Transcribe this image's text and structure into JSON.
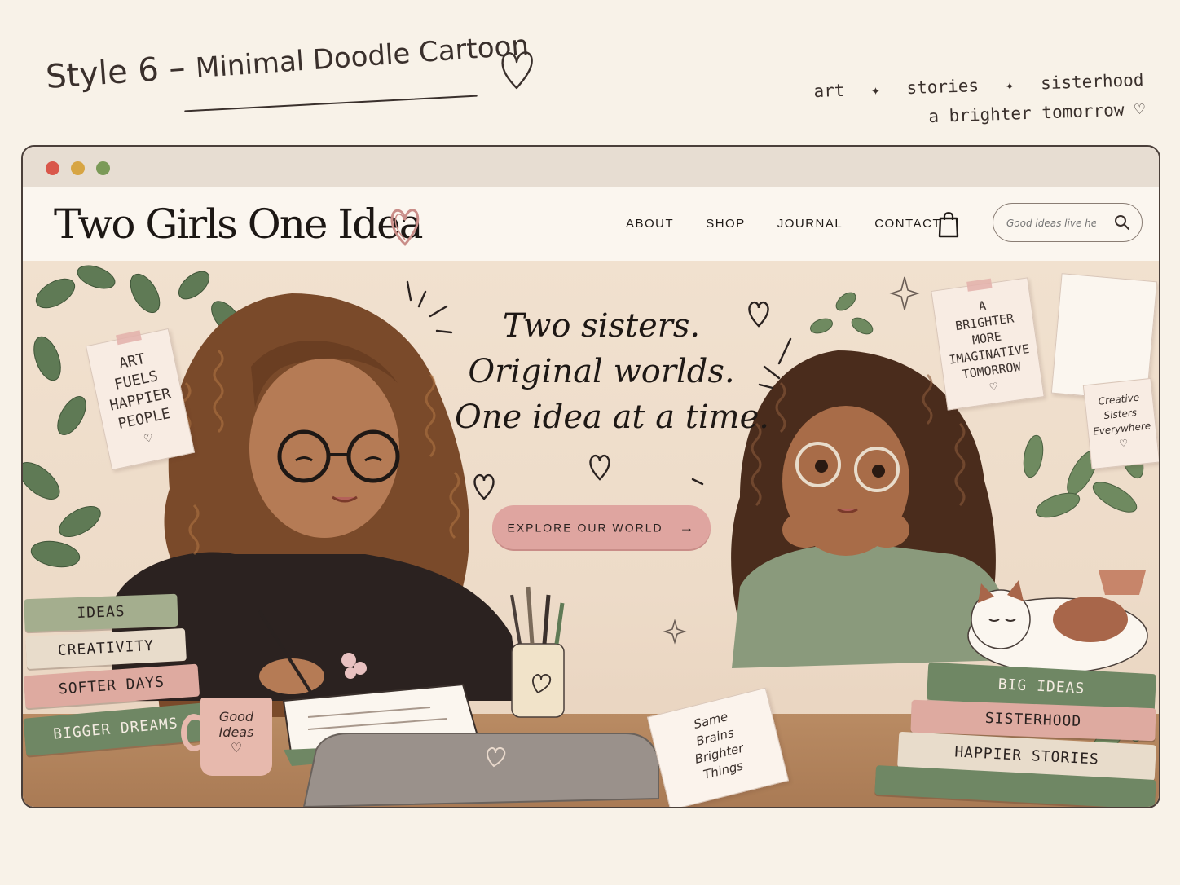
{
  "page": {
    "style_title": "Style 6",
    "style_dash": "–",
    "style_subtitle": "Minimal Doodle Cartoon",
    "tagline": {
      "line1_items": [
        "art",
        "stories",
        "sisterhood"
      ],
      "line2": "a brighter tomorrow"
    }
  },
  "browser": {
    "site_name": "Two Girls One Idea",
    "nav": [
      "ABOUT",
      "SHOP",
      "JOURNAL",
      "CONTACT"
    ],
    "search": {
      "placeholder": "Good ideas live here..."
    }
  },
  "hero": {
    "headline_lines": [
      "Two sisters.",
      "Original worlds.",
      "One idea at a time."
    ],
    "cta_label": "EXPLORE OUR WORLD",
    "cta_arrow": "→",
    "notes": {
      "left": [
        "ART",
        "FUELS",
        "HAPPIER",
        "PEOPLE"
      ],
      "right": [
        "A",
        "BRIGHTER",
        "MORE",
        "IMAGINATIVE",
        "TOMORROW"
      ],
      "creative": [
        "Creative",
        "Sisters",
        "Everywhere"
      ],
      "desk": [
        "Same",
        "Brains",
        "Brighter",
        "Things"
      ]
    },
    "mug_text": [
      "Good",
      "Ideas"
    ],
    "books_left": [
      "IDEAS",
      "CREATIVITY",
      "SOFTER DAYS",
      "BIGGER DREAMS"
    ],
    "books_right": [
      "BIG IDEAS",
      "SISTERHOOD",
      "HAPPIER STORIES"
    ]
  },
  "colors": {
    "background": "#f8f2e8",
    "cta": "#dfa5a0",
    "accent_heart": "#c98d88",
    "dot_red": "#d9574b",
    "dot_yellow": "#d7a544",
    "dot_green": "#7b9a58"
  },
  "icons": [
    "heart-icon",
    "shopping-bag-icon",
    "search-icon",
    "sparkle-icon",
    "arrow-right-icon"
  ]
}
